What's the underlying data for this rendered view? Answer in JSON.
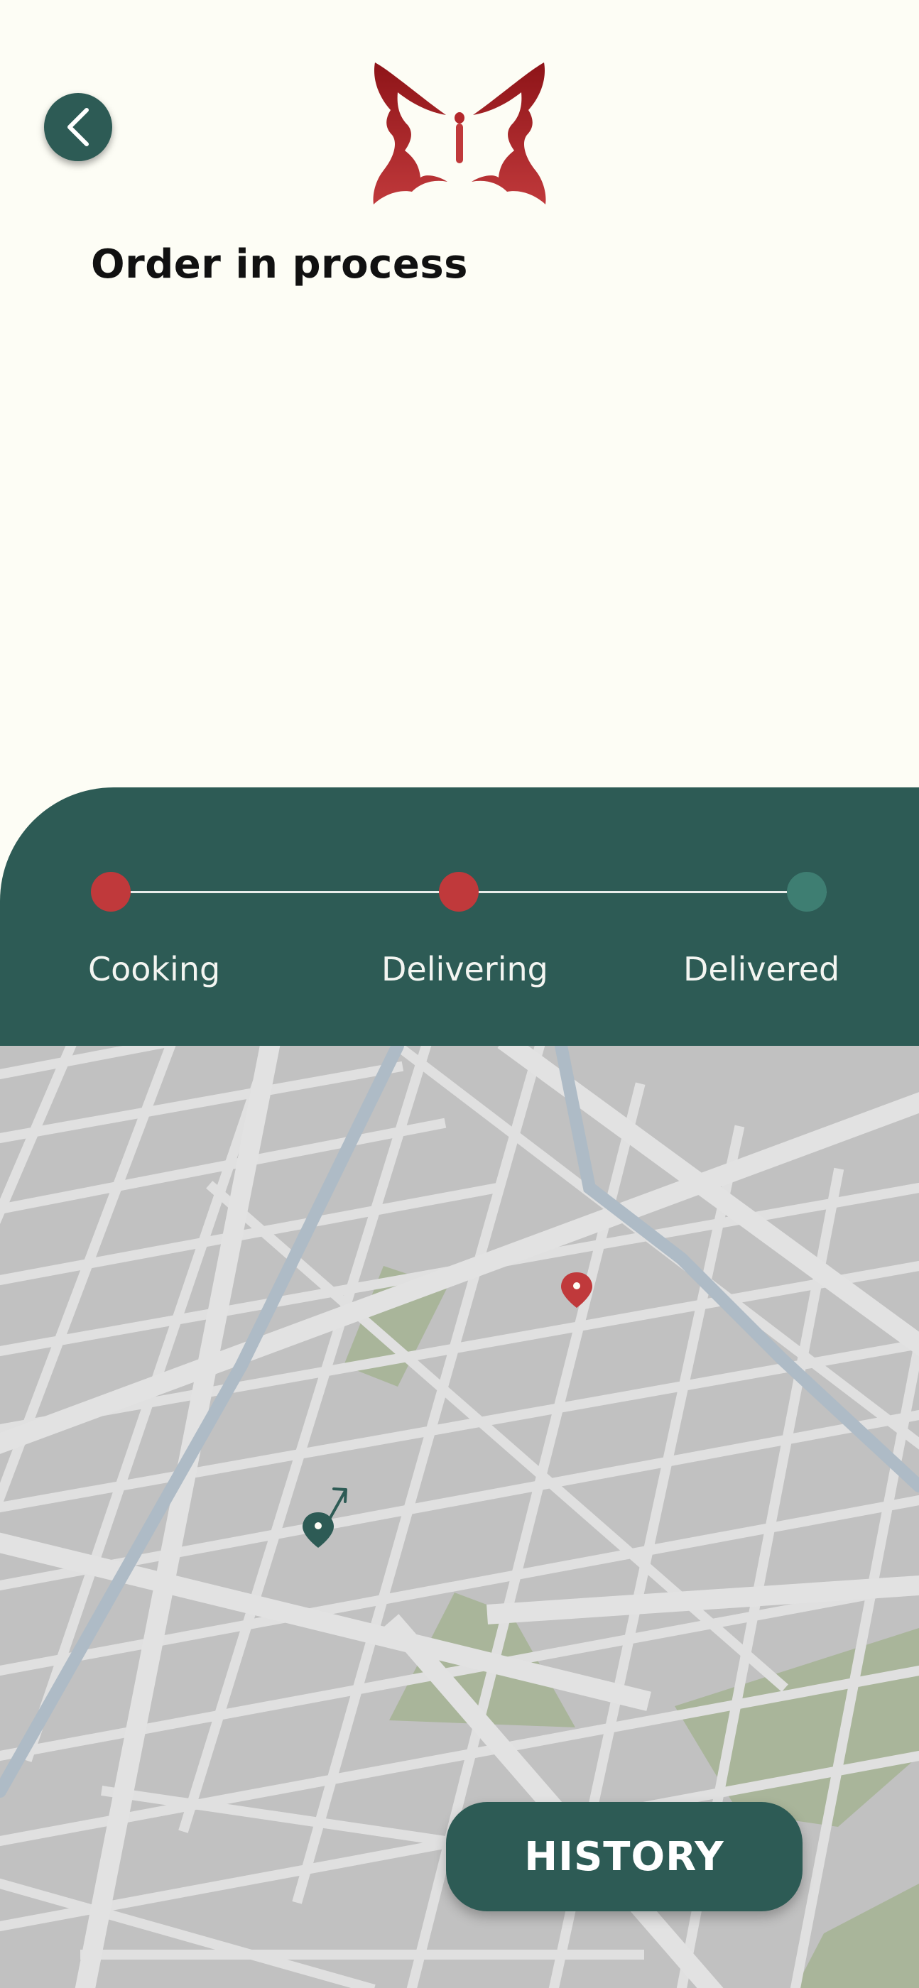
{
  "header": {
    "back_icon": "chevron-left-icon",
    "logo_icon": "butterfly-logo",
    "title": "Order in process"
  },
  "status": {
    "progress_fraction": 0.5,
    "steps": [
      {
        "label": "Cooking",
        "state": "done",
        "color": "#C0393B"
      },
      {
        "label": "Delivering",
        "state": "current",
        "color": "#C0393B"
      },
      {
        "label": "Delivered",
        "state": "pending",
        "color": "#3E7E72"
      }
    ]
  },
  "map": {
    "destination_icon": "location-pin-icon",
    "courier_icon": "courier-pin-icon",
    "direction_icon": "arrow-up-right-icon"
  },
  "actions": {
    "history_label": "HISTORY"
  },
  "colors": {
    "background": "#FDFDF5",
    "primary": "#2D5B55",
    "accent": "#C0393B",
    "pending": "#3E7E72",
    "map_block": "#C1C1C1",
    "map_road": "#E0E0E0",
    "map_park": "#A9B59A",
    "map_water": "#AEBBC6"
  }
}
